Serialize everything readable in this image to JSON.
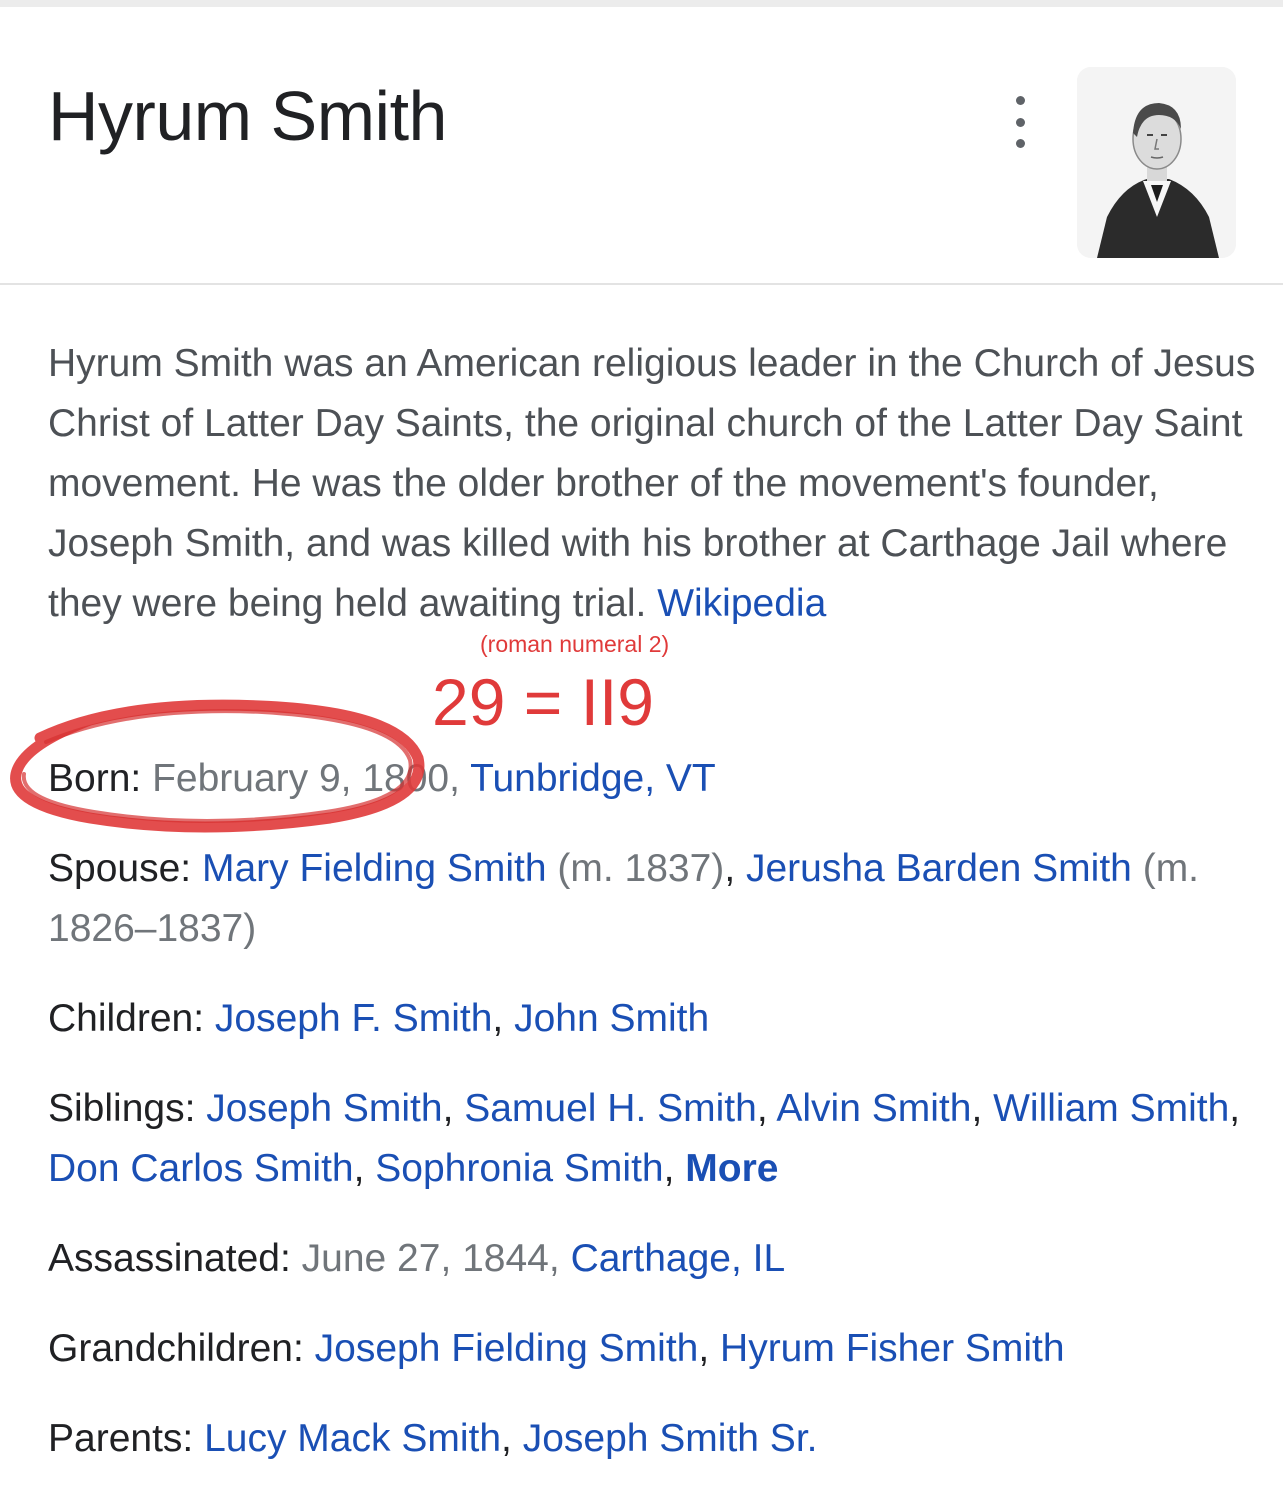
{
  "header": {
    "title": "Hyrum Smith",
    "more_icon": "more-vert-icon"
  },
  "description": {
    "text": "Hyrum Smith was an American religious leader in the Church of Jesus Christ of Latter Day Saints, the original church of the Latter Day Saint movement. He was the older brother of the movement's founder, Joseph Smith, and was killed with his brother at Carthage Jail where they were being held awaiting trial.",
    "source_link": "Wikipedia"
  },
  "facts": {
    "born": {
      "label": "Born:",
      "date": "February 9, 1800",
      "sep": ",",
      "place": "Tunbridge, VT"
    },
    "spouse": {
      "label": "Spouse:",
      "items": [
        {
          "name": "Mary Fielding Smith",
          "note": "(m. 1837)"
        },
        {
          "name": "Jerusha Barden Smith",
          "note": "(m. 1826–1837)"
        }
      ]
    },
    "children": {
      "label": "Children:",
      "items": [
        "Joseph F. Smith",
        "John Smith"
      ]
    },
    "siblings": {
      "label": "Siblings:",
      "items": [
        "Joseph Smith",
        "Samuel H. Smith",
        "Alvin Smith",
        "William Smith",
        "Don Carlos Smith",
        "Sophronia Smith"
      ],
      "more": "More"
    },
    "assassinated": {
      "label": "Assassinated:",
      "date": "June 27, 1844",
      "sep": ",",
      "place": "Carthage, IL"
    },
    "grandchildren": {
      "label": "Grandchildren:",
      "items": [
        "Joseph Fielding Smith",
        "Hyrum Fisher Smith"
      ]
    },
    "parents": {
      "label": "Parents:",
      "items": [
        "Lucy Mack Smith",
        "Joseph Smith Sr."
      ]
    }
  },
  "annotation": {
    "small": "(roman numeral 2)",
    "big": "29 = II9",
    "color": "#e03a3a"
  },
  "colors": {
    "link": "#1a4fb4",
    "text": "#202124",
    "muted": "#70757a",
    "annotation": "#e03a3a"
  }
}
